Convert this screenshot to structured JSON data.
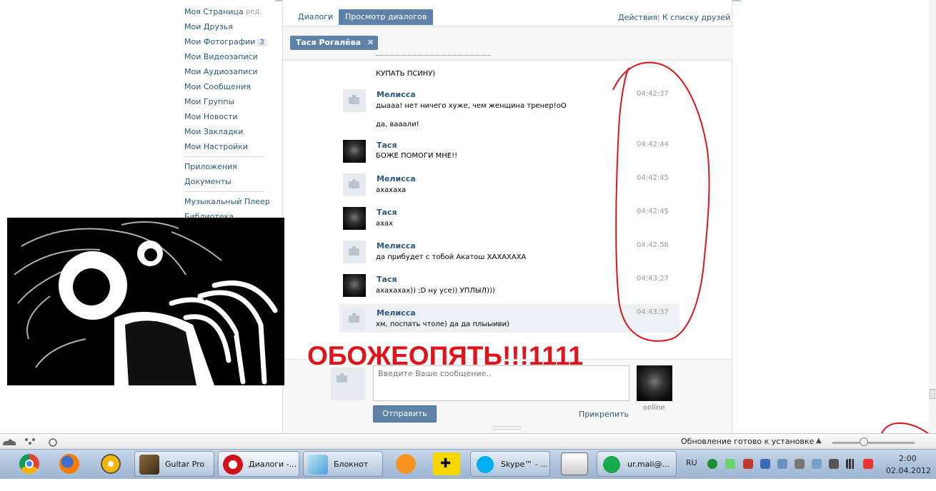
{
  "sidebar": {
    "items": [
      {
        "label": "Моя Страница"
      },
      {
        "label": "Мои Друзья"
      },
      {
        "label": "Мои Фотографии"
      },
      {
        "label": "Мои Видеозаписи"
      },
      {
        "label": "Мои Аудиозаписи"
      },
      {
        "label": "Мои Сообщения"
      },
      {
        "label": "Мои Группы"
      },
      {
        "label": "Мои Новости"
      },
      {
        "label": "Мои Закладки"
      },
      {
        "label": "Мои Настройки"
      },
      {
        "label": "Приложения"
      },
      {
        "label": "Документы"
      },
      {
        "label": "Музыкальный Плеер"
      },
      {
        "label": "Библиотека"
      }
    ],
    "edit_label": "ред.",
    "photos_count": "3"
  },
  "tabs": {
    "dialogs": "Диалоги",
    "view_dialogs": "Просмотр диалогов",
    "actions": "Действия",
    "separator": "|",
    "friends_list": "К списку друзей"
  },
  "peer": {
    "name": "Тася Рогалёва",
    "remove": "✖"
  },
  "messages": {
    "top_text": "КУПАТЬ ПСИНУ)",
    "items": [
      {
        "author": "Мелисса",
        "text": "дыааа! нет ничего хуже, чем женщина тренер!оО",
        "text2": "да, вааали!",
        "time": "04:42:37"
      },
      {
        "author": "Тася",
        "text": "БОЖЕ ПОМОГИ МНЕ!!",
        "time": "04:42:44"
      },
      {
        "author": "Мелисса",
        "text": "ахахаха",
        "time": "04:42:45"
      },
      {
        "author": "Тася",
        "text": "ахах",
        "time": "04:42:45"
      },
      {
        "author": "Мелисса",
        "text": "да прибудет с тобой Акатош ХАХАХАХА",
        "time": "04:42:56"
      },
      {
        "author": "Тася",
        "text": "ахахахах)) ;D ну усе)) УПЛЫЛ)))",
        "time": "04:43:27"
      },
      {
        "author": "Мелисса",
        "text": "хм, поспать чтоле) да да плыыиви)",
        "time": "04:43:37"
      }
    ]
  },
  "composer": {
    "placeholder": "Введите Ваше сообщение..",
    "send": "Отправить",
    "attach": "Прикрепить",
    "status": "online"
  },
  "caption": "ОБОЖЕОПЯТЬ!!!1111",
  "statusbar": {
    "update_text": "Обновление готово к установке"
  },
  "taskbar": {
    "buttons": [
      {
        "label": "Guitar Pro"
      },
      {
        "label": "Диалоги -..."
      },
      {
        "label": "Блокнот"
      },
      {
        "label": "Skype™ - ..."
      },
      {
        "label": "ur.mali@..."
      }
    ],
    "lang": "RU",
    "time": "2:00",
    "date": "02.04.2012"
  },
  "colors": {
    "accent": "#5e82a8",
    "link": "#2b587a",
    "annotation_red": "#e0141b"
  }
}
